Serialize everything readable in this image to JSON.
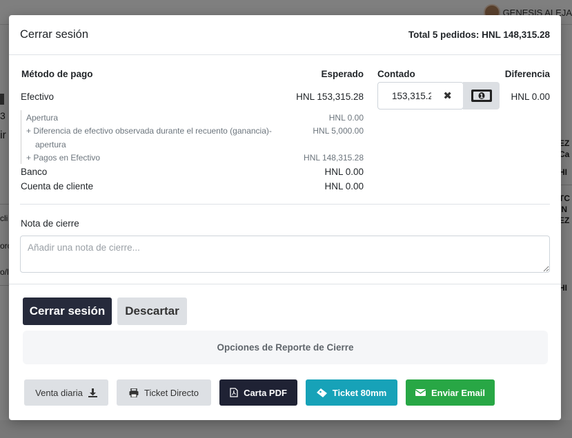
{
  "background": {
    "user_name": "GENESIS ALEJA",
    "right_fragments": [
      "EZ",
      "Ca",
      "",
      "HI",
      "",
      "TC",
      "IN",
      "EZ",
      "",
      "",
      "",
      "",
      "",
      "HI"
    ],
    "left_fragments": [
      "3",
      "ir",
      "cli",
      "orc",
      "o/l"
    ]
  },
  "modal": {
    "title": "Cerrar sesión",
    "total": "Total 5 pedidos: HNL 148,315.28",
    "headers": {
      "method": "Método de pago",
      "expected": "Esperado",
      "counted": "Contado",
      "difference": "Diferencia"
    },
    "cash": {
      "label": "Efectivo",
      "expected": "HNL 153,315.28",
      "counted_value": "153,315.2",
      "difference": "HNL 0.00",
      "clear_icon": "times-icon",
      "count_icon": "money-bill-icon",
      "details": [
        {
          "label": "Apertura",
          "amount": "HNL 0.00"
        },
        {
          "label": "+ Diferencia de efectivo observada durante el recuento (ganancia)-",
          "label2": "apertura",
          "amount": "HNL 5,000.00"
        },
        {
          "label": "+ Pagos en Efectivo",
          "amount": "HNL 148,315.28"
        }
      ]
    },
    "bank": {
      "label": "Banco",
      "expected": "HNL 0.00"
    },
    "customer_account": {
      "label": "Cuenta de cliente",
      "expected": "HNL 0.00"
    },
    "note": {
      "label": "Nota de cierre",
      "placeholder": "Añadir una nota de cierre..."
    },
    "actions": {
      "close": "Cerrar sesión",
      "discard": "Descartar"
    },
    "report": {
      "title": "Opciones de Reporte de Cierre",
      "buttons": [
        {
          "label": "Venta diaria",
          "icon": "download-icon"
        },
        {
          "label": "Ticket Directo",
          "icon": "printer-icon"
        },
        {
          "label": "Carta PDF",
          "icon": "file-pdf-icon"
        },
        {
          "label": "Ticket 80mm",
          "icon": "ticket-icon"
        },
        {
          "label": "Enviar Email",
          "icon": "envelope-icon"
        }
      ]
    },
    "colors": {
      "primary_dark": "#262a3b",
      "info": "#17a2b8",
      "success": "#28a745",
      "secondary": "#dde0e4"
    }
  }
}
